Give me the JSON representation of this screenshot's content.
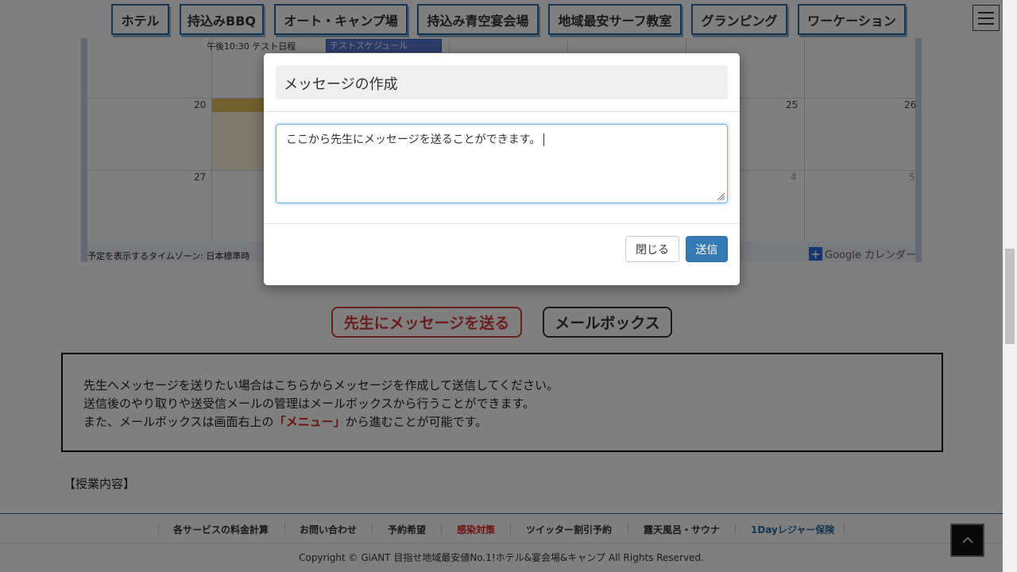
{
  "nav": {
    "items": [
      {
        "label": "ホテル"
      },
      {
        "label": "持込みBBQ"
      },
      {
        "label": "オート・キャンプ場"
      },
      {
        "label": "持込み青空宴会場"
      },
      {
        "label": "地域最安サーフ教室"
      },
      {
        "label": "グランピング"
      },
      {
        "label": "ワーケーション"
      }
    ]
  },
  "calendar": {
    "event_time_label": "午後10:30 テスト日程",
    "event_block_label": "テストスケジュール",
    "day_numbers": {
      "d20": "20",
      "d25": "25",
      "d26": "26",
      "d27": "27",
      "d4": "4",
      "d5": "5"
    },
    "timezone_text": "予定を表示するタイムゾーン: 日本標準時",
    "google_calendar_label": "Google カレンダー"
  },
  "actions": {
    "send_message_label": "先生にメッセージを送る",
    "mailbox_label": "メールボックス"
  },
  "info": {
    "line1": "先生へメッセージを送りたい場合はこちらからメッセージを作成して送信してください。",
    "line2": "送信後のやり取りや送受信メールの管理はメールボックスから行うことができます。",
    "line3_before": "また、メールボックスは画面右上の",
    "line3_highlight": "「メニュー」",
    "line3_after": "から進むことが可能です。"
  },
  "section": {
    "class_content_title": "【授業内容】"
  },
  "footer": {
    "links": [
      {
        "label": "各サービスの料金計算"
      },
      {
        "label": "お問い合わせ"
      },
      {
        "label": "予約希望"
      },
      {
        "label": "感染対策"
      },
      {
        "label": "ツイッター割引予約"
      },
      {
        "label": "露天風呂・サウナ"
      },
      {
        "label": "1Dayレジャー保険"
      }
    ],
    "copyright": "Copyright © GiANT 目指せ地域最安値No.1!ホテル&宴会場&キャンプ All Rights Reserved."
  },
  "modal": {
    "title": "メッセージの作成",
    "textarea_value": "ここから先生にメッセージを送ることができます。",
    "close_label": "閉じる",
    "send_label": "送信"
  },
  "colors": {
    "nav_border": "#2a6aa0",
    "accent_red": "#d62020",
    "primary_button": "#337ab7"
  },
  "icons": {
    "menu": "hamburger-menu-icon",
    "back_to_top": "chevron-up-icon",
    "google_plus": "plus-icon",
    "resize": "resize-grip-icon"
  }
}
